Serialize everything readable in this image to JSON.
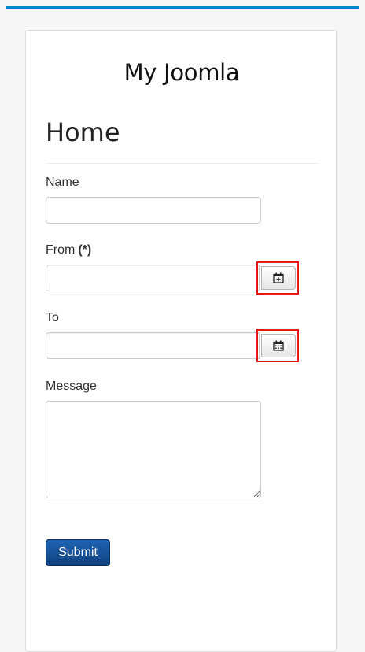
{
  "site": {
    "title": "My Joomla"
  },
  "page": {
    "title": "Home"
  },
  "form": {
    "name": {
      "label": "Name",
      "value": "",
      "placeholder": ""
    },
    "from": {
      "label": "From",
      "required_mark": "(*)",
      "value": "",
      "placeholder": "",
      "calendar_icon": "calendar-plus-icon"
    },
    "to": {
      "label": "To",
      "value": "",
      "placeholder": "",
      "calendar_icon": "calendar-icon"
    },
    "message": {
      "label": "Message",
      "value": "",
      "placeholder": ""
    },
    "submit_label": "Submit"
  },
  "colors": {
    "top_bar": "#0088cc",
    "submit_bg": "#10427f",
    "highlight_box": "#e11818"
  }
}
